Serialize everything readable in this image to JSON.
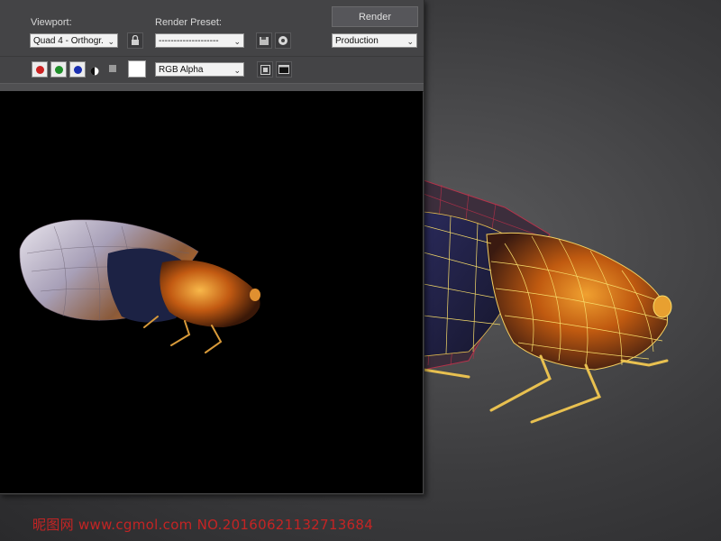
{
  "render_window": {
    "viewport_label": "Viewport:",
    "viewport_value": "Quad 4 - Orthogr.",
    "render_preset_label": "Render Preset:",
    "render_preset_value": "--------------------",
    "render_button": "Render",
    "production_value": "Production",
    "channel_value": "RGB Alpha",
    "icons": {
      "lock": "lock-icon",
      "save_preset": "save-preset-icon",
      "settings": "render-setup-icon",
      "red": "red-channel-icon",
      "green": "green-channel-icon",
      "blue": "blue-channel-icon",
      "mono": "monochrome-icon",
      "clear": "clear-icon",
      "swatch": "color-swatch",
      "display_alpha": "display-alpha-icon",
      "frame": "frame-window-icon"
    },
    "colors": {
      "red": "#cc2222",
      "green": "#1f8f2a",
      "blue": "#1a2fb0"
    }
  },
  "watermark": "昵图网 www.cgmol.com NO.20160621132713684"
}
